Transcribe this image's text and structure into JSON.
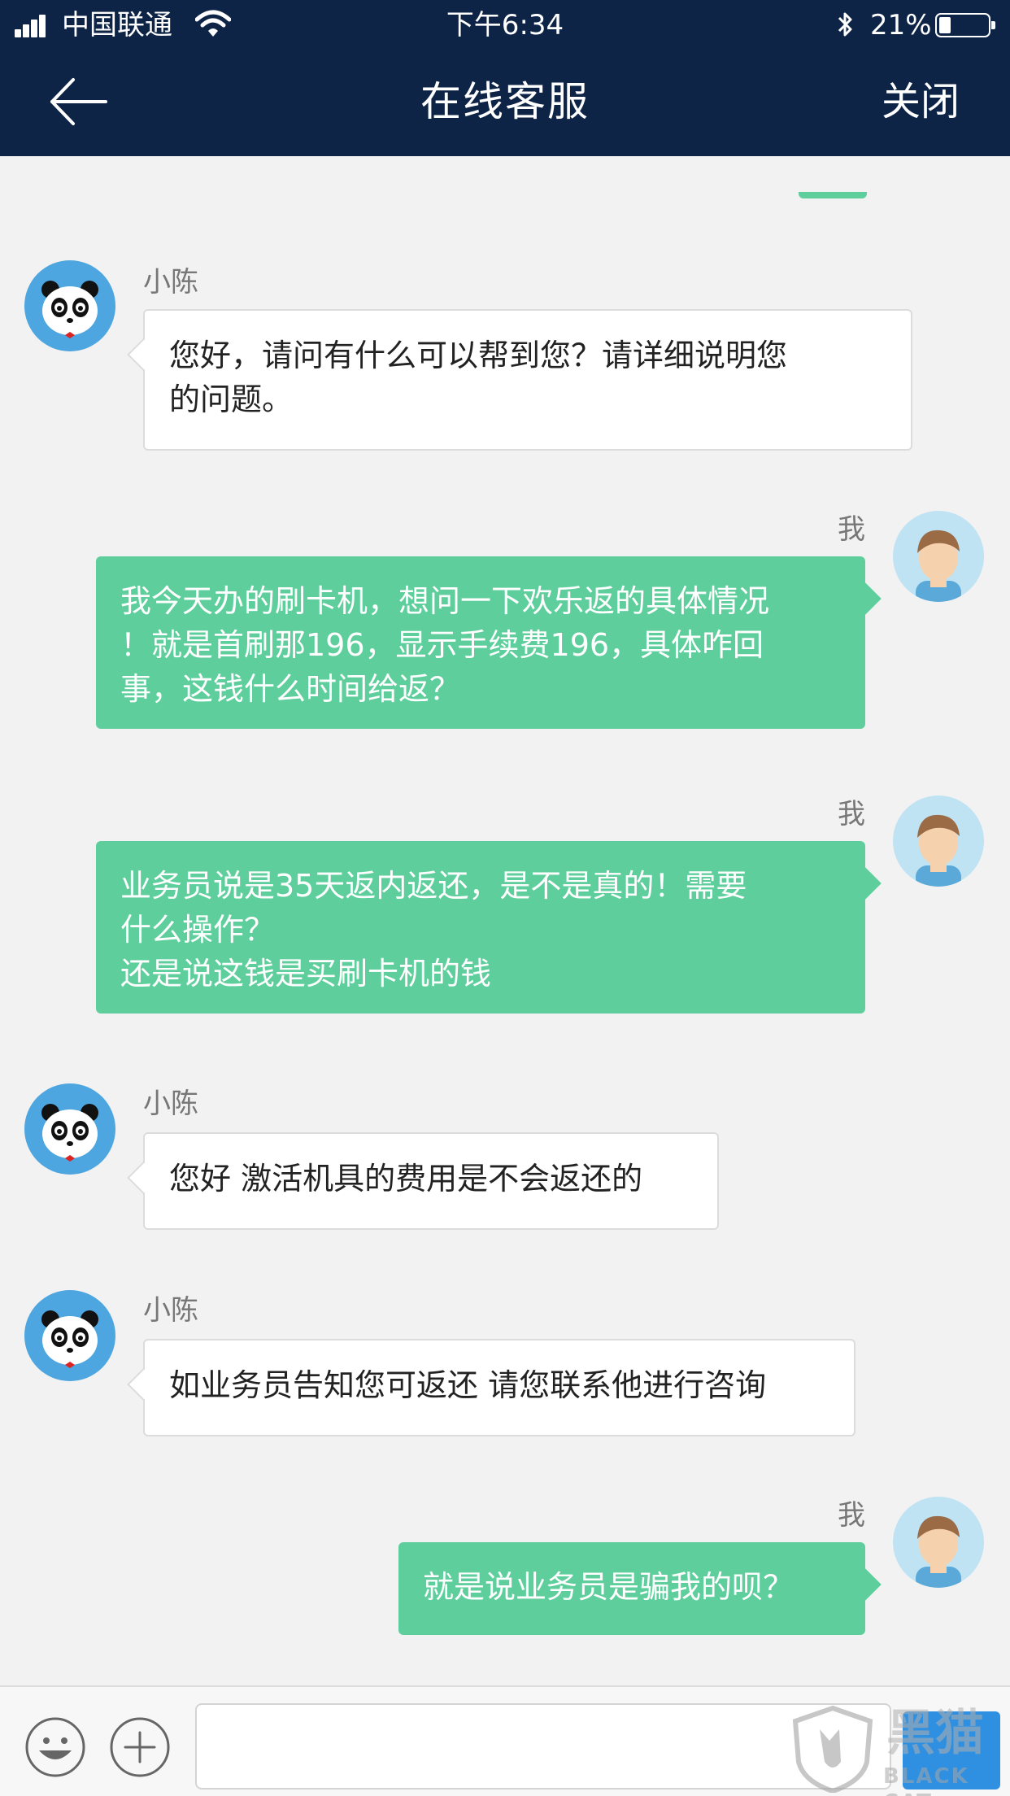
{
  "status_bar": {
    "carrier": "中国联通",
    "time": "下午6:34",
    "battery_percent_text": "21%",
    "battery_level": 0.21
  },
  "navbar": {
    "title": "在线客服",
    "close_label": "关闭"
  },
  "messages": [
    {
      "from": "agent",
      "name": "小陈",
      "lines": [
        "您好，请问有什么可以帮到您？请详细说明您",
        "的问题。"
      ]
    },
    {
      "from": "user",
      "name": "我",
      "lines": [
        "我今天办的刷卡机，想问一下欢乐返的具体情况",
        "！就是首刷那196，显示手续费196，具体咋回",
        "事，这钱什么时间给返？"
      ]
    },
    {
      "from": "user",
      "name": "我",
      "lines": [
        "业务员说是35天返内返还，是不是真的！需要",
        "什么操作？",
        "还是说这钱是买刷卡机的钱"
      ]
    },
    {
      "from": "agent",
      "name": "小陈",
      "lines": [
        "您好 激活机具的费用是不会返还的"
      ]
    },
    {
      "from": "agent",
      "name": "小陈",
      "lines": [
        "如业务员告知您可返还 请您联系他进行咨询"
      ]
    },
    {
      "from": "user",
      "name": "我",
      "lines": [
        "就是说业务员是骗我的呗？"
      ]
    }
  ],
  "composer": {
    "input_value": "",
    "watermark_text": "黑猫",
    "watermark_sub": "BLACK CAT"
  },
  "colors": {
    "header_bg": "#0e2446",
    "user_bubble": "#5ecf9c",
    "agent_avatar_bg": "#4ea6e0",
    "send_button": "#2f8fe0"
  }
}
